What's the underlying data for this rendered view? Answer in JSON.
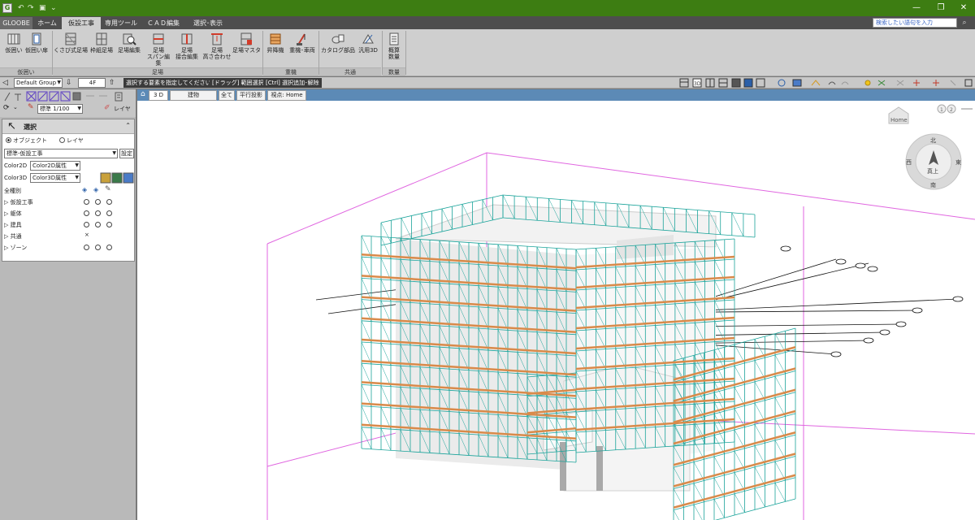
{
  "app": {
    "logo": "G",
    "window_controls": [
      "—",
      "❐",
      "✕"
    ]
  },
  "ribbon_tabs": [
    {
      "label": "GLOOBE",
      "active": false
    },
    {
      "label": "ホーム",
      "active": false
    },
    {
      "label": "仮設工事",
      "active": true
    },
    {
      "label": "専用ツール",
      "active": false
    },
    {
      "label": "ＣＡＤ編集",
      "active": false
    },
    {
      "label": "選択･表示",
      "active": false
    }
  ],
  "help_search": {
    "placeholder": "検索したい語句を入力"
  },
  "ribbon": {
    "groups": [
      {
        "name": "仮囲い",
        "buttons": [
          "仮囲い",
          "仮囲い扉"
        ]
      },
      {
        "name": "足場",
        "buttons": [
          "くさび式足場",
          "枠組足場",
          "足場編集",
          "足場\nスパン編集",
          "足場\n接合編集",
          "足場\n高さ合わせ",
          "足場マスタ"
        ]
      },
      {
        "name": "重機",
        "buttons": [
          "昇降機",
          "重機･車両"
        ]
      },
      {
        "name": "共通",
        "buttons": [
          "カタログ部品",
          "汎用3D"
        ]
      },
      {
        "name": "数量",
        "buttons": [
          "概算\n数量"
        ]
      }
    ]
  },
  "cmdbar": {
    "group_select": "Default Group",
    "floor_select": "4F",
    "prompt": "選択する要素を指定してください。",
    "hint1": "[ドラッグ] 範囲選択",
    "hint2": "[Ctrl] 選択追加･解除"
  },
  "left_tools": {
    "scale_select": "標準 1/100",
    "layer_button": "レイヤ"
  },
  "select_panel": {
    "title": "選択",
    "mode_object": "オブジェクト",
    "mode_layer": "レイヤ",
    "preset": "標準-仮設工事",
    "settings": "設定",
    "color2d_label": "Color2D",
    "color2d_value": "Color2D属性",
    "color3d_label": "Color3D",
    "color3d_value": "Color3D属性",
    "category_all": "全種別",
    "categories": [
      "仮設工事",
      "躯体",
      "建具",
      "共通",
      "ゾーン"
    ]
  },
  "viewport": {
    "tabs": [
      "3 D",
      "建物",
      "全て",
      "平行投影",
      "視点: Home"
    ],
    "nav": {
      "home": "Home",
      "north": "北",
      "east": "東",
      "south": "南",
      "west": "西",
      "top": "真上",
      "page1": "1",
      "page2": "2"
    }
  },
  "colors": {
    "title_green": "#3d7d12",
    "scaffold_teal": "#1aa39a",
    "plank_orange": "#d98a4a",
    "bounding_magenta": "#e066e0"
  }
}
